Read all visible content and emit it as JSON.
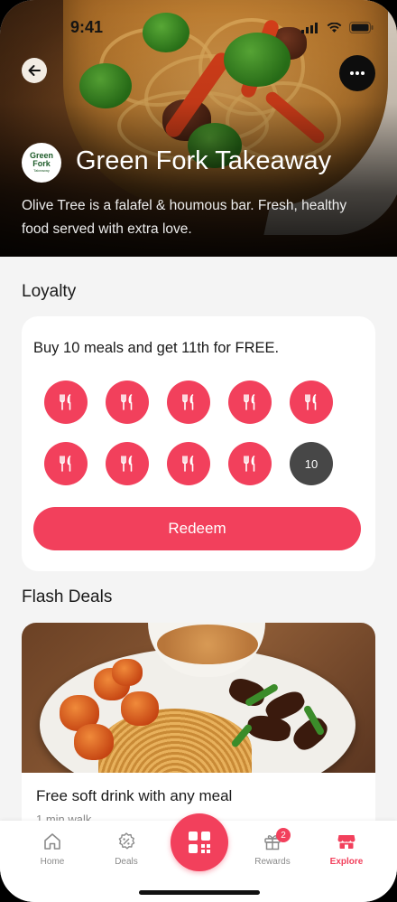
{
  "status": {
    "time": "9:41"
  },
  "store": {
    "logo_line1": "Green",
    "logo_line2": "Fork",
    "logo_line3": "Takeaway",
    "name": "Green Fork Takeaway",
    "description": "Olive Tree is a falafel & houmous bar. Fresh, healthy food served with extra love."
  },
  "loyalty": {
    "section_title": "Loyalty",
    "offer": "Buy 10 meals and get 11th for FREE.",
    "stamps_collected": 9,
    "stamps_total": 10,
    "pending_label": "10",
    "redeem_label": "Redeem"
  },
  "flash_deals": {
    "section_title": "Flash Deals",
    "deals": [
      {
        "title": "Free soft drink with any meal",
        "subtitle": "1 min walk"
      }
    ]
  },
  "tabbar": {
    "home": "Home",
    "deals": "Deals",
    "rewards": "Rewards",
    "rewards_badge": "2",
    "explore": "Explore",
    "active": "explore"
  },
  "colors": {
    "accent": "#f2405c",
    "pending_stamp": "#474747"
  },
  "icons": [
    "back-arrow-icon",
    "more-icon",
    "fork-knife-icon",
    "home-icon",
    "deals-icon",
    "qr-code-icon",
    "gift-icon",
    "store-icon"
  ]
}
